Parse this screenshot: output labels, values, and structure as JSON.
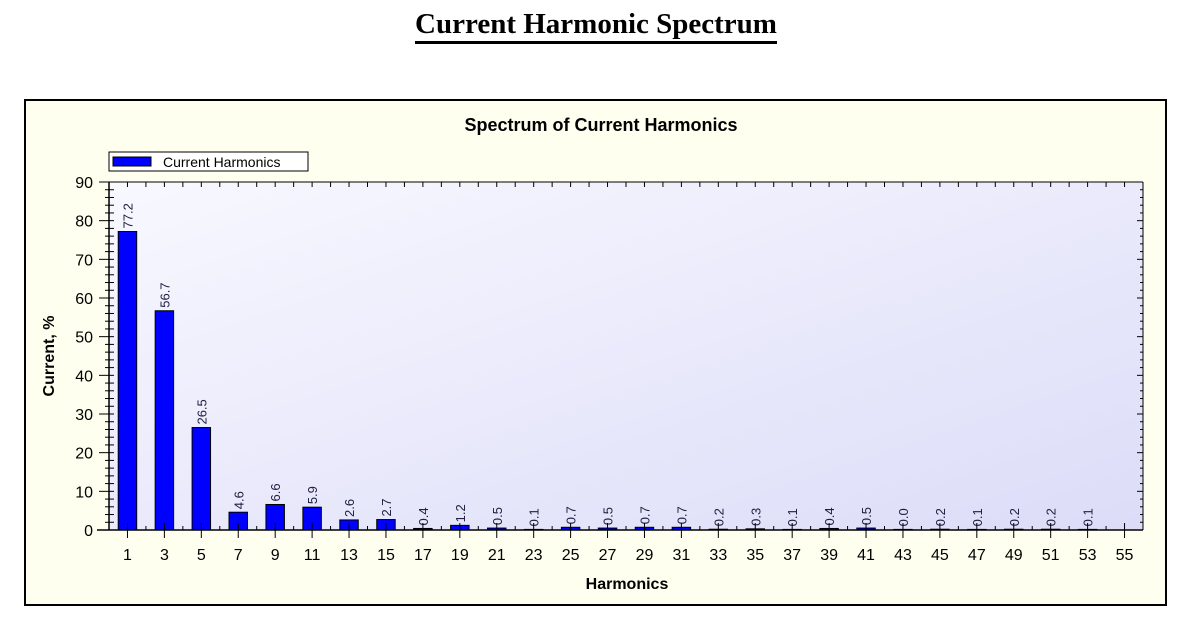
{
  "page": {
    "title": "Current Harmonic Spectrum"
  },
  "chart_data": {
    "type": "bar",
    "title": "Spectrum of Current Harmonics",
    "xlabel": "Harmonics",
    "ylabel": "Current, %",
    "ylim": [
      0,
      90
    ],
    "yticks": [
      0,
      10,
      20,
      30,
      40,
      50,
      60,
      70,
      80,
      90
    ],
    "grid": false,
    "legend": {
      "position": "top-left",
      "entries": [
        "Current Harmonics"
      ]
    },
    "categories": [
      "1",
      "3",
      "5",
      "7",
      "9",
      "11",
      "13",
      "15",
      "17",
      "19",
      "21",
      "23",
      "25",
      "27",
      "29",
      "31",
      "33",
      "35",
      "37",
      "39",
      "41",
      "43",
      "45",
      "47",
      "49",
      "51",
      "53",
      "55"
    ],
    "series": [
      {
        "name": "Current Harmonics",
        "color": "#0000ff",
        "values": [
          77.2,
          56.7,
          26.5,
          4.6,
          6.6,
          5.9,
          2.6,
          2.7,
          0.4,
          1.2,
          0.5,
          0.1,
          0.7,
          0.5,
          0.7,
          0.7,
          0.2,
          0.3,
          0.1,
          0.4,
          0.5,
          0.0,
          0.2,
          0.1,
          0.2,
          0.2,
          0.1,
          null
        ],
        "labels": [
          "77.2",
          "56.7",
          "26.5",
          "4.6",
          "6.6",
          "5.9",
          "2.6",
          "2.7",
          "0.4",
          "1.2",
          "0.5",
          "0.1",
          "0.7",
          "0.5",
          "0.7",
          "0.7",
          "0.2",
          "0.3",
          "0.1",
          "0.4",
          "0.5",
          "0.0",
          "0.2",
          "0.1",
          "0.2",
          "0.2",
          "0.1",
          ""
        ]
      }
    ],
    "colors": {
      "plot_bg_top": "#f8f8ff",
      "plot_bg_bottom": "#dcdcf8",
      "frame_bg": "#fffff0",
      "bar": "#0000ff",
      "label_text": "#202040"
    }
  }
}
